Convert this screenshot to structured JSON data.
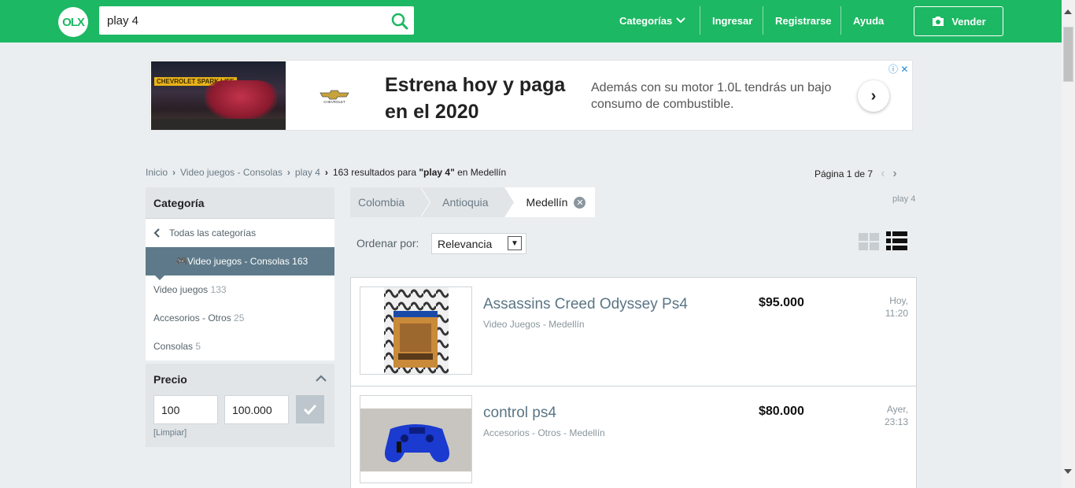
{
  "header": {
    "logo_text": "OLX",
    "search_value": "play 4",
    "nav": {
      "categorias": "Categorías",
      "ingresar": "Ingresar",
      "registrarse": "Registrarse",
      "ayuda": "Ayuda"
    },
    "vender_label": "Vender"
  },
  "ad": {
    "image_tag": "CHEVROLET SPARK LIFE",
    "brand": "CHEVROLET",
    "headline": "Estrena hoy y paga en el 2020",
    "body": "Además con su motor 1.0L tendrás un bajo consumo de combustible."
  },
  "breadcrumb": {
    "inicio": "Inicio",
    "categoria": "Video juegos - Consolas",
    "query": "play 4",
    "count": "163",
    "result_prefix": "resultados para",
    "result_query": "\"play 4\"",
    "result_suffix": "en Medellín"
  },
  "pager": {
    "text": "Página 1 de 7"
  },
  "sidebar": {
    "cat_title": "Categoría",
    "all_label": "Todas las categorías",
    "selected": {
      "label": "Video juegos - Consolas",
      "count": "163"
    },
    "items": [
      {
        "label": "Video juegos",
        "count": "133"
      },
      {
        "label": "Accesorios - Otros",
        "count": "25"
      },
      {
        "label": "Consolas",
        "count": "5"
      }
    ],
    "price_title": "Precio",
    "price_min": "100",
    "price_max": "100.000",
    "limpiar": "[Limpiar]"
  },
  "location": {
    "colombia": "Colombia",
    "antioquia": "Antioquia",
    "medellin": "Medellín",
    "tag": "play 4"
  },
  "sort": {
    "label": "Ordenar por:",
    "value": "Relevancia"
  },
  "listings": [
    {
      "title": "Assassins Creed Odyssey Ps4",
      "subtitle": "Video Juegos - Medellín",
      "price": "$95.000",
      "date_day": "Hoy,",
      "date_time": "11:20"
    },
    {
      "title": "control ps4",
      "subtitle": "Accesorios - Otros - Medellín",
      "price": "$80.000",
      "date_day": "Ayer,",
      "date_time": "23:13"
    }
  ],
  "colors": {
    "brand_green": "#1db863",
    "selected_category": "#5e7a8a",
    "link_blue_gray": "#5a7585"
  }
}
